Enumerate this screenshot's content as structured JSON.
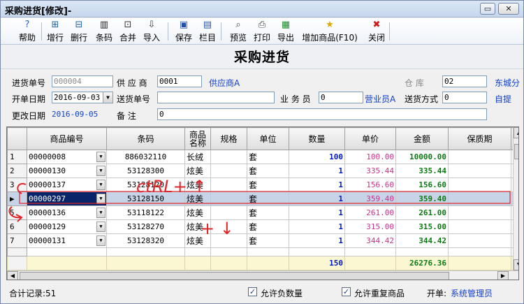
{
  "window": {
    "title": "采购进货[修改]-",
    "min_glyph": "▭",
    "close_glyph": "✕"
  },
  "toolbar": [
    {
      "name": "help-button",
      "icon": "help-icon",
      "glyph": "?",
      "color": "#3060c0",
      "label": "帮助"
    },
    {
      "name": "add-row-button",
      "icon": "add-row-icon",
      "glyph": "⊞",
      "color": "#2060a0",
      "label": "增行"
    },
    {
      "name": "delete-row-button",
      "icon": "delete-row-icon",
      "glyph": "⊟",
      "color": "#2060a0",
      "label": "删行"
    },
    {
      "name": "barcode-button",
      "icon": "barcode-icon",
      "glyph": "▥",
      "color": "#222222",
      "label": "条码"
    },
    {
      "name": "merge-button",
      "icon": "merge-icon",
      "glyph": "⊡",
      "color": "#333333",
      "label": "合并"
    },
    {
      "name": "import-button",
      "icon": "import-icon",
      "glyph": "⇩",
      "color": "#333333",
      "label": "导入"
    },
    {
      "name": "save-button",
      "icon": "save-icon",
      "glyph": "▣",
      "color": "#1f4fa8",
      "label": "保存"
    },
    {
      "name": "columns-button",
      "icon": "columns-icon",
      "glyph": "▤",
      "color": "#2a5aa0",
      "label": "栏目"
    },
    {
      "name": "preview-button",
      "icon": "preview-icon",
      "glyph": "⌕",
      "color": "#444444",
      "label": "预览"
    },
    {
      "name": "print-button",
      "icon": "print-icon",
      "glyph": "⎙",
      "color": "#444444",
      "label": "打印"
    },
    {
      "name": "export-button",
      "icon": "export-excel-icon",
      "glyph": "▦",
      "color": "#1c8a2c",
      "label": "导出"
    },
    {
      "name": "add-product-button",
      "icon": "star-icon",
      "glyph": "★",
      "color": "#e0a800",
      "label": "增加商品(F10)"
    },
    {
      "name": "close-button",
      "icon": "close-icon",
      "glyph": "✖",
      "color": "#d01818",
      "label": "关闭"
    }
  ],
  "heading": "采购进货",
  "form": {
    "order_no_label": "进货单号",
    "order_no": "000004",
    "supplier_label": "供 应 商",
    "supplier_code": "0001",
    "supplier_name": "供应商A",
    "warehouse_label": "仓   库",
    "warehouse_code": "02",
    "warehouse_name": "东城分",
    "open_date_label": "开单日期",
    "open_date": "2016-09-03",
    "delivery_no_label": "送货单号",
    "delivery_no": "",
    "salesman_label": "业 务 员",
    "salesman_code": "0",
    "salesman_name": "营业员A",
    "delivery_method_label": "送货方式",
    "delivery_method_code": "0",
    "delivery_method_name": "自提",
    "change_date_label": "更改日期",
    "change_date": "2016-09-05",
    "remark_label": "备   注",
    "remark": "0"
  },
  "grid": {
    "headers": [
      "商品编号",
      "条码",
      "商品名称",
      "规格",
      "单位",
      "数量",
      "单价",
      "金额",
      "保质期"
    ],
    "rows": [
      {
        "no": "1",
        "code": "00000008",
        "barcode": "886032110",
        "name": "长绒",
        "spec": "",
        "unit": "套",
        "qty": "100",
        "price": "100.00",
        "amount": "10000.00"
      },
      {
        "no": "2",
        "code": "00000130",
        "barcode": "53128300",
        "name": "炫美",
        "spec": "",
        "unit": "套",
        "qty": "1",
        "price": "335.44",
        "amount": "335.44"
      },
      {
        "no": "3",
        "code": "00000137",
        "barcode": "53128120",
        "name": "炫美",
        "spec": "",
        "unit": "套",
        "qty": "1",
        "price": "156.60",
        "amount": "156.60"
      },
      {
        "no": "▶",
        "code": "00000297",
        "barcode": "53128150",
        "name": "炫美",
        "spec": "",
        "unit": "套",
        "qty": "1",
        "price": "359.40",
        "amount": "359.40",
        "selected": true
      },
      {
        "no": "5",
        "code": "00000136",
        "barcode": "53118122",
        "name": "炫美",
        "spec": "",
        "unit": "套",
        "qty": "1",
        "price": "261.00",
        "amount": "261.00"
      },
      {
        "no": "6",
        "code": "00000129",
        "barcode": "53128270",
        "name": "炫美",
        "spec": "",
        "unit": "套",
        "qty": "1",
        "price": "315.00",
        "amount": "315.00"
      },
      {
        "no": "7",
        "code": "00000131",
        "barcode": "53128320",
        "name": "炫美",
        "spec": "",
        "unit": "套",
        "qty": "1",
        "price": "344.42",
        "amount": "344.42"
      }
    ],
    "total_qty": "150",
    "total_amount": "26276.36"
  },
  "status": {
    "records": "合计记录:51",
    "allow_negative": "允许负数量",
    "allow_duplicate": "允许重复商品",
    "check_glyph": "✓",
    "opener_label": "开单:",
    "opener": "系统管理员"
  },
  "annotations": {
    "ctrl_up": "ctRL+ ↑",
    "ctrl_down": "+ ↓"
  },
  "colors": {
    "selection": "#0a246a",
    "qty": "#0019c0",
    "price": "#c8348a",
    "amount": "#0e7a14",
    "link": "#1440c8",
    "annotation": "#e0242a"
  }
}
